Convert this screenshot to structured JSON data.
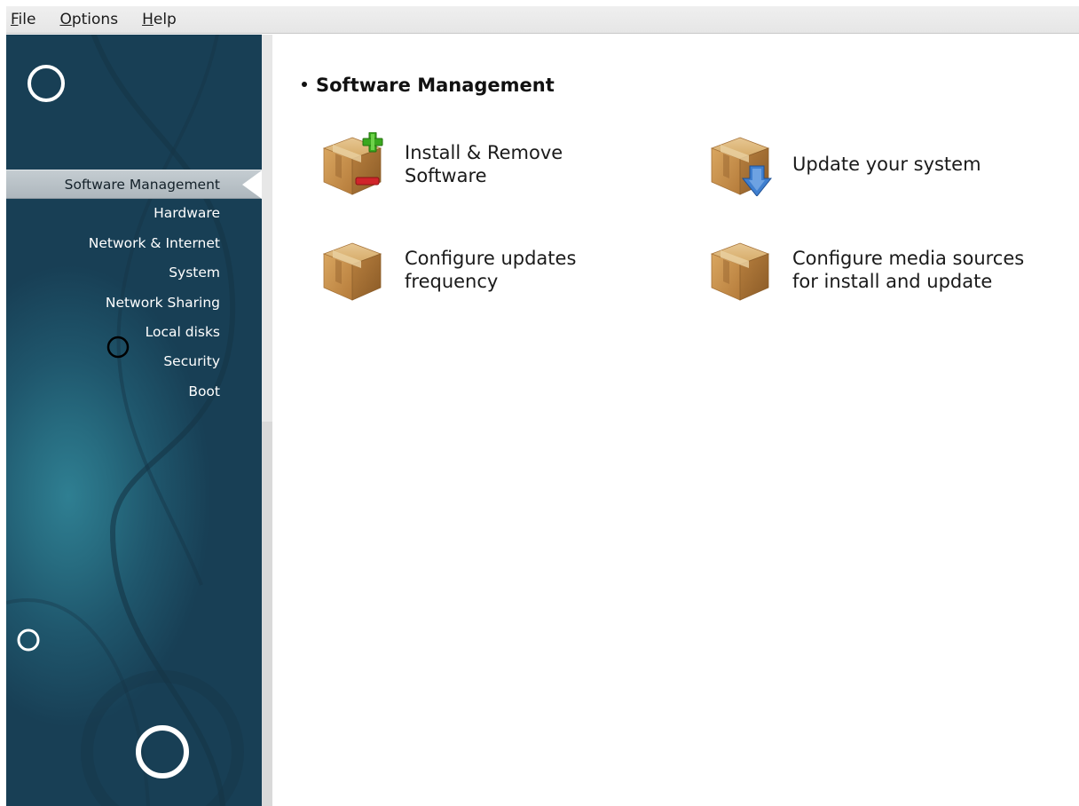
{
  "menubar": {
    "items": [
      {
        "mnemonic": "F",
        "rest": "ile"
      },
      {
        "mnemonic": "O",
        "rest": "ptions"
      },
      {
        "mnemonic": "H",
        "rest": "elp"
      }
    ]
  },
  "sidebar": {
    "items": [
      {
        "label": "Software Management",
        "active": true
      },
      {
        "label": "Hardware"
      },
      {
        "label": "Network & Internet"
      },
      {
        "label": "System"
      },
      {
        "label": "Network Sharing"
      },
      {
        "label": "Local disks"
      },
      {
        "label": "Security"
      },
      {
        "label": "Boot"
      }
    ]
  },
  "main": {
    "section_title": "Software Management",
    "tools": [
      {
        "line1": "Install & Remove",
        "line2": "Software",
        "icon": "box-add-remove-icon"
      },
      {
        "line1": "Update your system",
        "line2": "",
        "icon": "box-update-icon"
      },
      {
        "line1": "Configure updates",
        "line2": "frequency",
        "icon": "box-icon"
      },
      {
        "line1": "Configure media sources",
        "line2": "for install and update",
        "icon": "box-icon"
      }
    ]
  },
  "colors": {
    "sidebar_dark": "#183f55",
    "sidebar_mid": "#276c80",
    "box_tan": "#c8964f",
    "add_green": "#3aa81f",
    "remove_red": "#d0252a",
    "arrow_blue": "#3f7fcf"
  }
}
